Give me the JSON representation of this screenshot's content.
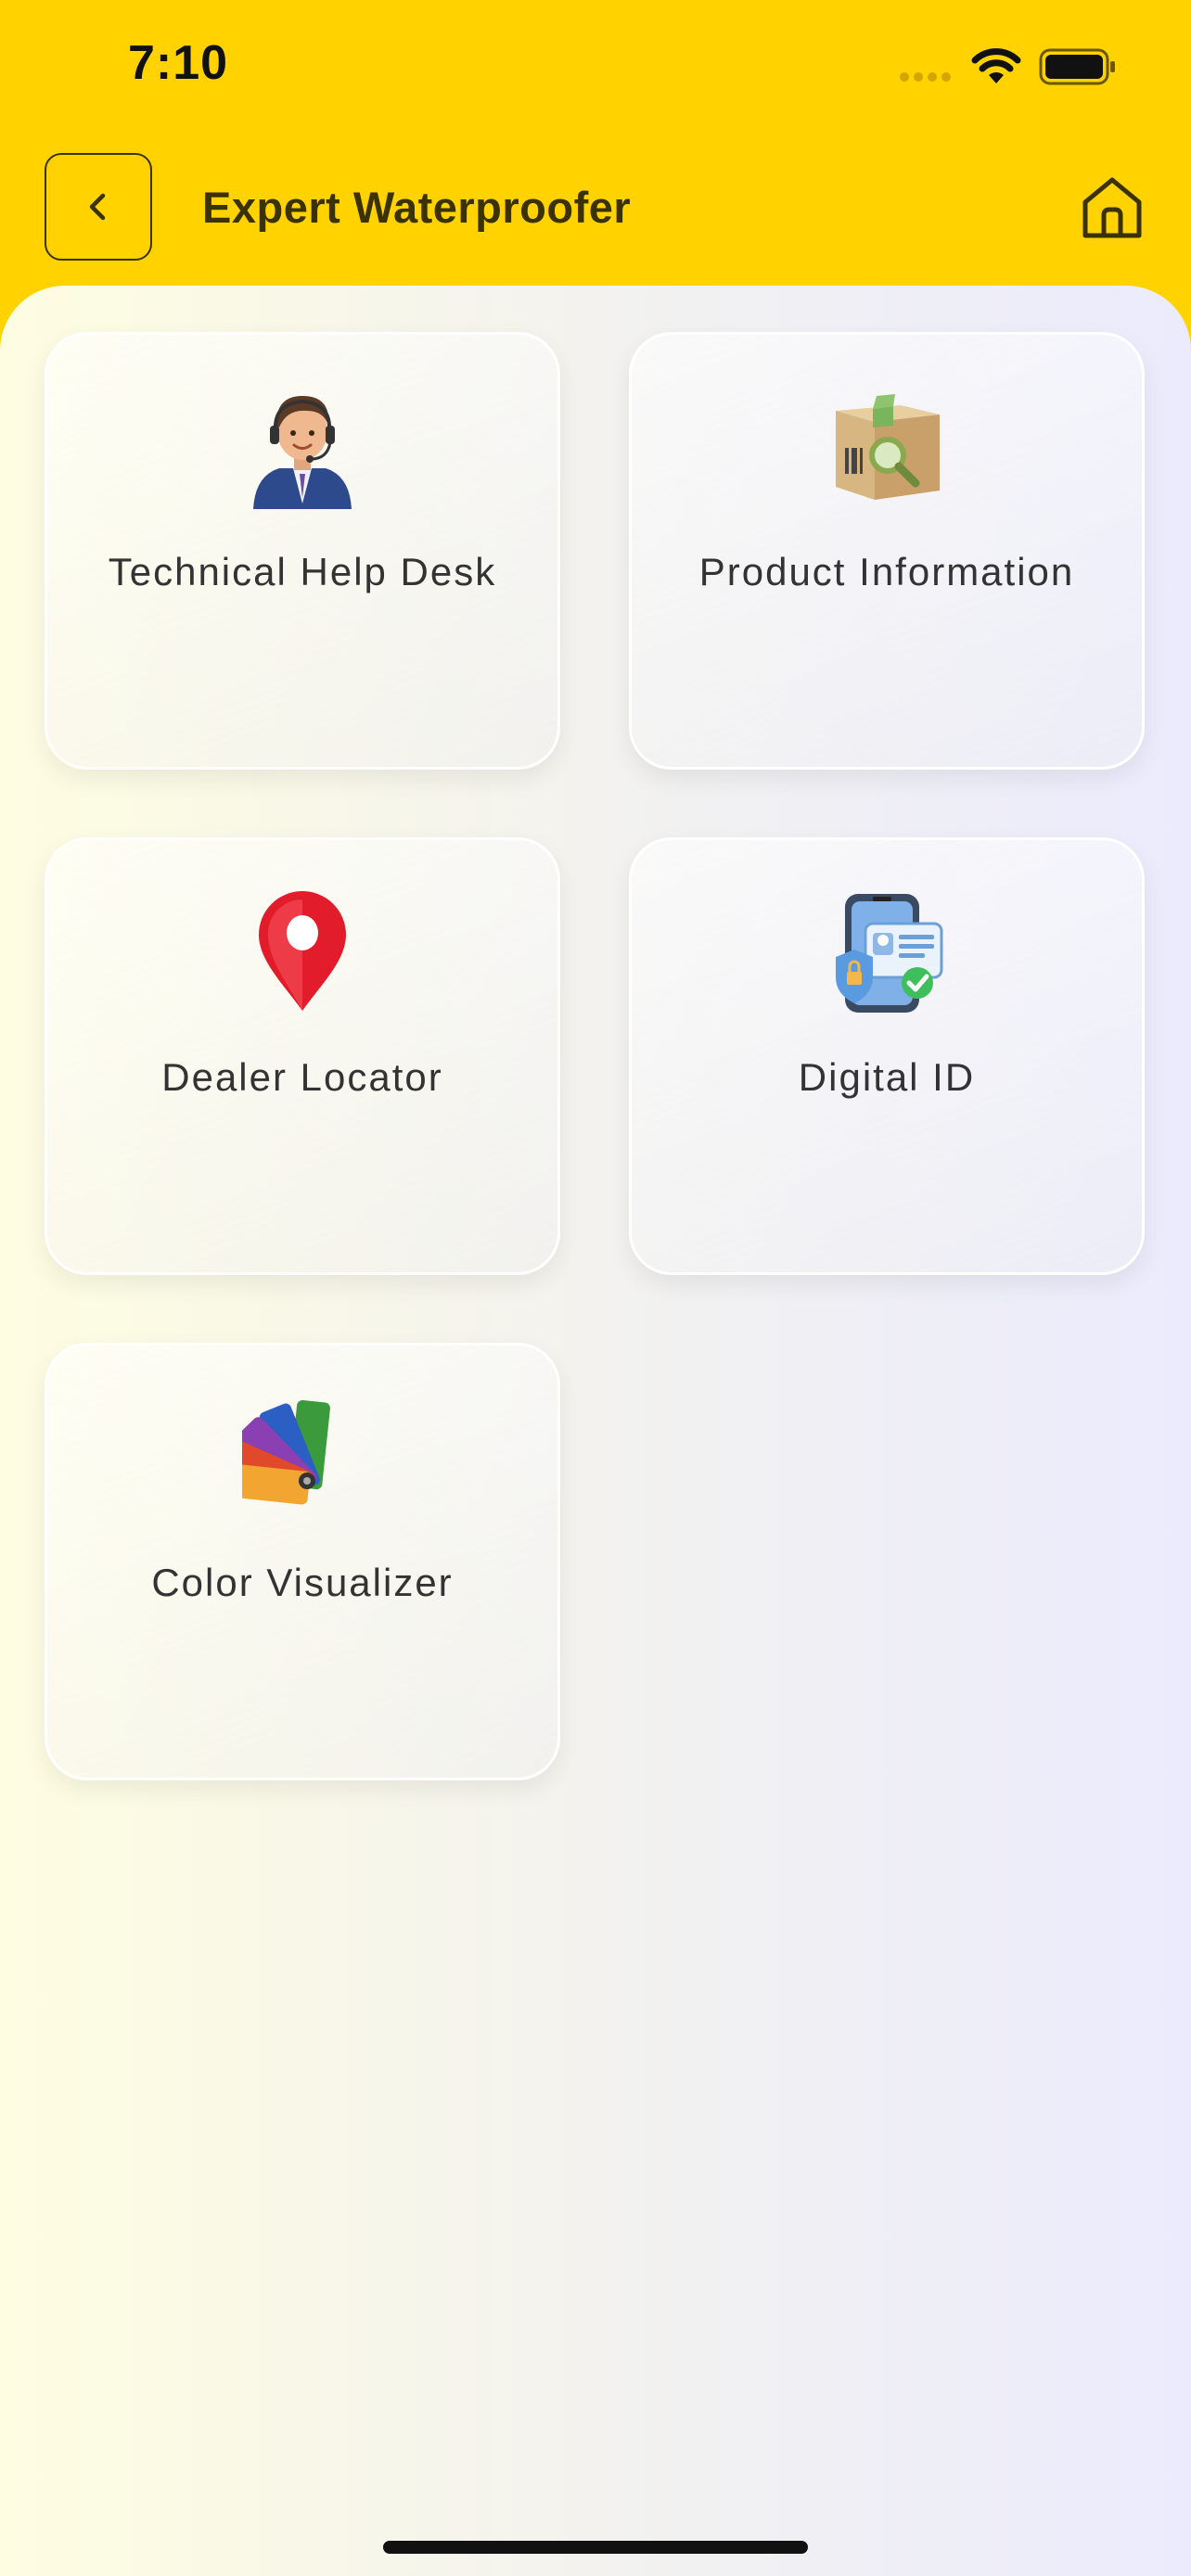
{
  "status_bar": {
    "time": "7:10"
  },
  "header": {
    "title": "Expert Waterproofer"
  },
  "menu": {
    "items": [
      {
        "label": "Technical Help Desk",
        "icon": "support-agent-icon"
      },
      {
        "label": "Product Information",
        "icon": "product-box-icon"
      },
      {
        "label": "Dealer Locator",
        "icon": "location-pin-icon"
      },
      {
        "label": "Digital ID",
        "icon": "digital-id-icon"
      },
      {
        "label": "Color Visualizer",
        "icon": "color-palette-icon"
      }
    ]
  },
  "colors": {
    "header_background": "#FFD200",
    "title_text": "#3A3200"
  }
}
